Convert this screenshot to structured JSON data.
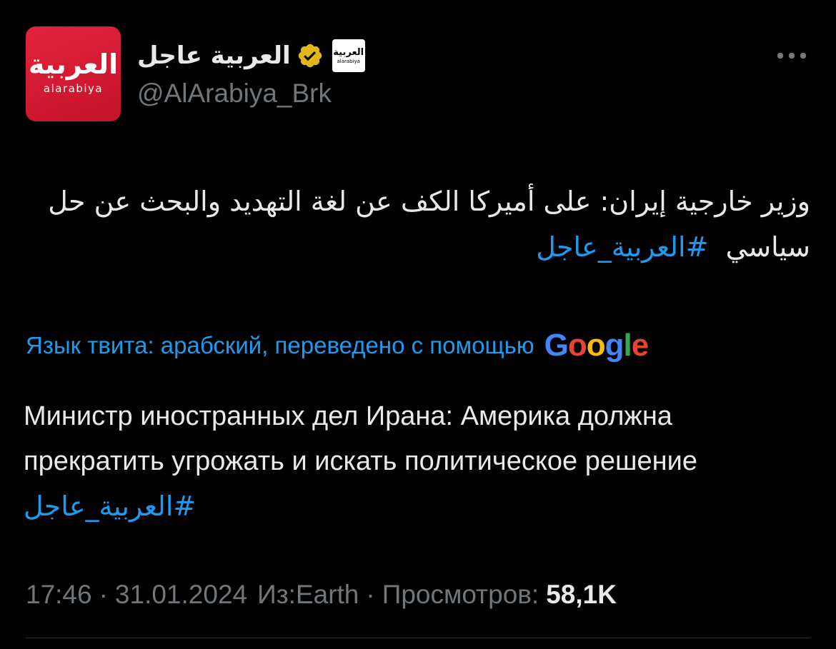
{
  "account": {
    "display_name": "العربية عاجل",
    "handle": "@AlArabiya_Brk",
    "avatar_text_ar": "العربية",
    "avatar_text_en": "alarabiya",
    "badge_logo_text_ar": "العربية",
    "badge_logo_text_en": "alarabiya",
    "verified_badge_color": "#e2b719",
    "avatar_color": "#d61a33"
  },
  "more_menu": {
    "icon": "more-horizontal-icon"
  },
  "tweet": {
    "arabic_text": "وزير خارجية إيران: على أميركا الكف عن لغة التهديد والبحث عن حل سياسي",
    "arabic_hashtag": "#العربية_عاجل"
  },
  "translation": {
    "label": "Язык твита: арабский, переведено с помощью",
    "provider": "Google",
    "text": "Министр иностранных дел Ирана: Америка должна прекратить угрожать и искать политическое решение",
    "hashtag": "#العربية_عاجل"
  },
  "meta": {
    "time": "17:46",
    "separator": "·",
    "date": "31.01.2024",
    "source": "Из:Earth",
    "views_label": "Просмотров:",
    "views_count": "58,1K"
  },
  "colors": {
    "background": "#000000",
    "text": "#e7e9ea",
    "secondary": "#71767b",
    "link": "#1d9bf0",
    "divider": "#2f3336"
  }
}
